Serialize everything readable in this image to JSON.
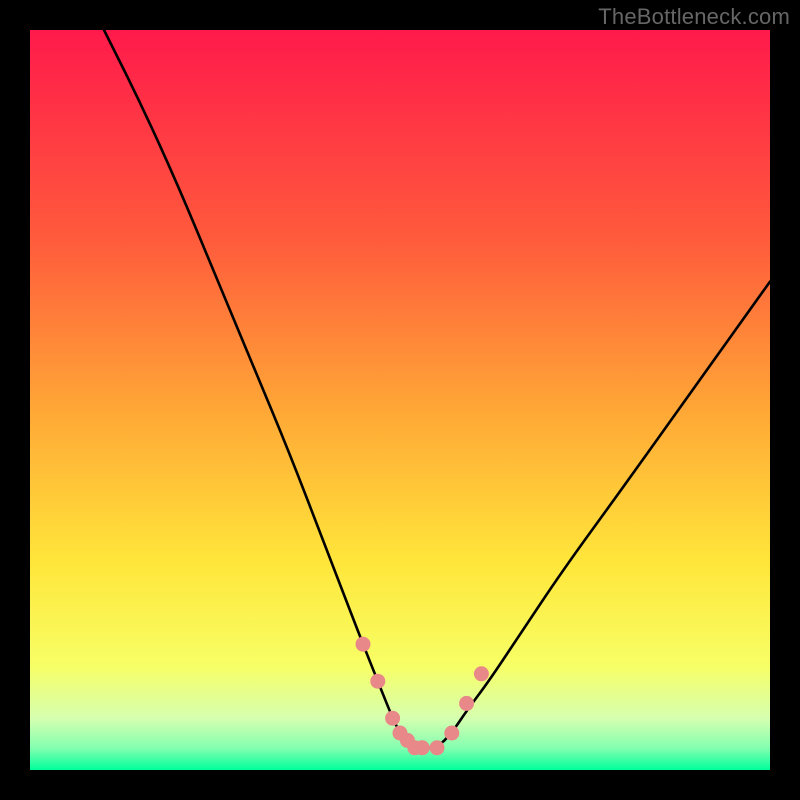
{
  "watermark": "TheBottleneck.com",
  "chart_data": {
    "type": "line",
    "title": "",
    "xlabel": "",
    "ylabel": "",
    "xlim": [
      0,
      100
    ],
    "ylim": [
      0,
      100
    ],
    "grid": false,
    "legend": false,
    "background_gradient_stops": [
      {
        "pos": 0.0,
        "color": "#ff1a4b"
      },
      {
        "pos": 0.28,
        "color": "#ff5a3c"
      },
      {
        "pos": 0.52,
        "color": "#ffa936"
      },
      {
        "pos": 0.72,
        "color": "#ffe63a"
      },
      {
        "pos": 0.86,
        "color": "#f7ff66"
      },
      {
        "pos": 0.93,
        "color": "#d6ffb0"
      },
      {
        "pos": 0.97,
        "color": "#84ffb0"
      },
      {
        "pos": 1.0,
        "color": "#00ff9c"
      }
    ],
    "series": [
      {
        "name": "bottleneck-curve",
        "color": "#000000",
        "x": [
          10,
          15,
          20,
          25,
          30,
          35,
          40,
          45,
          47,
          49,
          50,
          51,
          52,
          53,
          55,
          57,
          59,
          62,
          66,
          72,
          80,
          90,
          100
        ],
        "y": [
          100,
          90,
          79,
          67,
          55,
          43,
          30,
          17,
          12,
          7,
          5,
          4,
          3,
          3,
          3,
          5,
          8,
          12,
          18,
          27,
          38,
          52,
          66
        ]
      }
    ],
    "markers": {
      "name": "highlight-dots",
      "color": "#e98888",
      "x": [
        45,
        47,
        49,
        50,
        51,
        52,
        53,
        55,
        57,
        59,
        61
      ],
      "y": [
        17,
        12,
        7,
        5,
        4,
        3,
        3,
        3,
        5,
        9,
        13
      ]
    }
  }
}
